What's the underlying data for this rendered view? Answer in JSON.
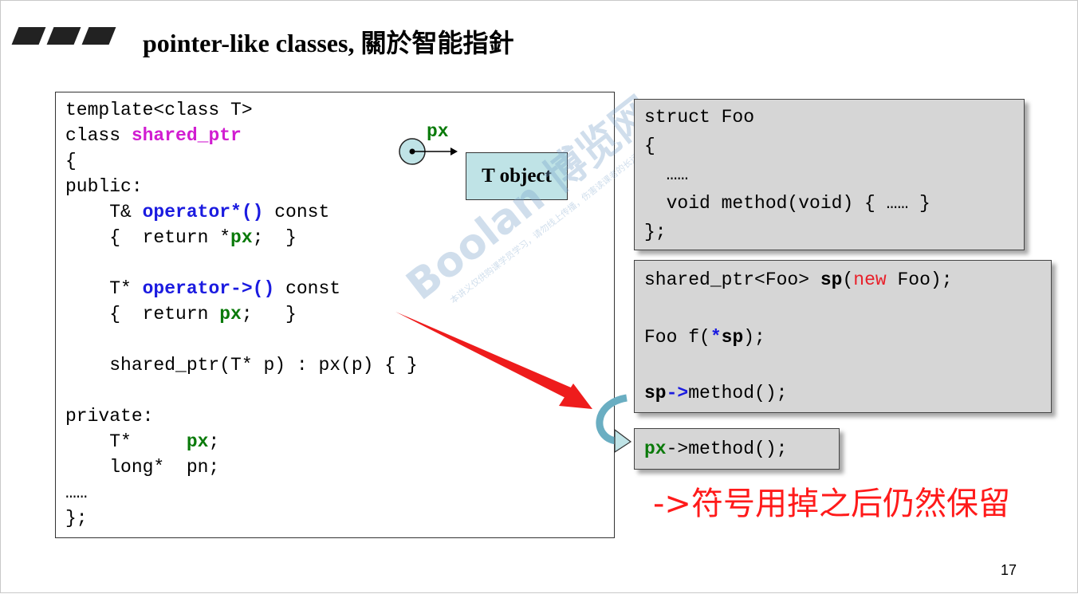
{
  "slide": {
    "title": "pointer-like classes, 關於智能指針",
    "page_number": "17",
    "annotation": "->符号用掉之后仍然保留"
  },
  "left_code": {
    "l1": "template<class T>",
    "l2_pre": "class ",
    "l2_name": "shared_ptr",
    "l3": "{",
    "l4": "public:",
    "l5_pre": "    T& ",
    "l5_op": "operator*()",
    "l5_post": " const",
    "l6_pre": "    {  return *",
    "l6_px": "px",
    "l6_post": ";  }",
    "l7_pre": "    T* ",
    "l7_op": "operator->()",
    "l7_post": " const",
    "l8_pre": "    {  return ",
    "l8_px": "px",
    "l8_post": ";   }",
    "l9": "    shared_ptr(T* p) : px(p) { }",
    "l10": "private:",
    "l11_pre": "    T*     ",
    "l11_px": "px",
    "l11_post": ";",
    "l12": "    long*  pn;",
    "l13": "……",
    "l14": "};"
  },
  "diagram": {
    "px_label": "px",
    "t_object_label": "T object"
  },
  "foo_code": {
    "l1": "struct Foo",
    "l2": "{",
    "l3": "  ……",
    "l4": "  void method(void) { …… }",
    "l5": "};"
  },
  "usage_code": {
    "l1_pre": "shared_ptr<Foo> ",
    "l1_sp": "sp",
    "l1_paren": "(",
    "l1_new": "new",
    "l1_post": " Foo);",
    "l2_pre": "Foo f(",
    "l2_star": "*",
    "l2_sp": "sp",
    "l2_post": ");",
    "l3_sp": "sp",
    "l3_arrow": "->",
    "l3_post": "method();"
  },
  "px_code": {
    "px": "px",
    "post": "->method();"
  },
  "watermark": {
    "brand": "Boolan 博览网",
    "notice": "本讲义仅供购课学员学习，请勿线上传播，伤害读课者的长远利益"
  },
  "colors": {
    "magenta": "#d11dd1",
    "blue": "#1b1be0",
    "green": "#0a7a0a",
    "red": "#e8202a",
    "teal": "#bfe3e6",
    "gray": "#d6d6d6"
  }
}
